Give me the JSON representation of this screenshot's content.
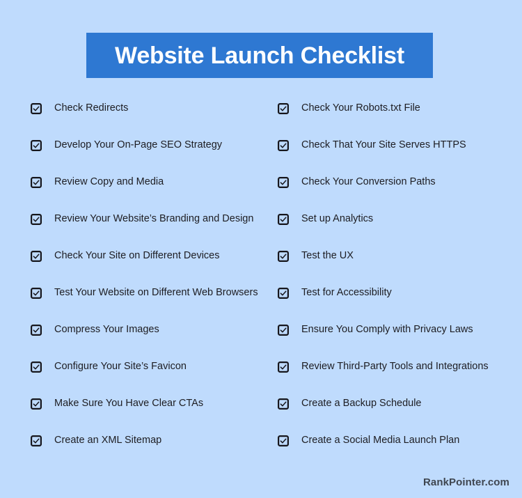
{
  "header": {
    "title": "Website Launch Checklist",
    "banner_color": "#2e78d2",
    "title_color": "#ffffff"
  },
  "page": {
    "background_color": "#bfdbfd",
    "text_color": "#1d1d22"
  },
  "checklist": {
    "checkbox_icon": "checkbox-checked-icon",
    "left_column": [
      {
        "label": "Check Redirects",
        "checked": true
      },
      {
        "label": "Develop Your On-Page SEO Strategy",
        "checked": true
      },
      {
        "label": "Review Copy and Media",
        "checked": true
      },
      {
        "label": "Review Your Website’s Branding and Design",
        "checked": true
      },
      {
        "label": "Check Your Site on Different Devices",
        "checked": true
      },
      {
        "label": "Test Your Website on Different Web Browsers",
        "checked": true
      },
      {
        "label": "Compress Your Images",
        "checked": true
      },
      {
        "label": "Configure Your Site’s Favicon",
        "checked": true
      },
      {
        "label": "Make Sure You Have Clear CTAs",
        "checked": true
      },
      {
        "label": "Create an XML Sitemap",
        "checked": true
      }
    ],
    "right_column": [
      {
        "label": "Check Your Robots.txt File",
        "checked": true
      },
      {
        "label": "Check That Your Site Serves HTTPS",
        "checked": true
      },
      {
        "label": "Check Your Conversion Paths",
        "checked": true
      },
      {
        "label": "Set up Analytics",
        "checked": true
      },
      {
        "label": "Test the UX",
        "checked": true
      },
      {
        "label": "Test for Accessibility",
        "checked": true
      },
      {
        "label": "Ensure You Comply with Privacy Laws",
        "checked": true
      },
      {
        "label": "Review Third-Party Tools and Integrations",
        "checked": true
      },
      {
        "label": "Create a Backup Schedule",
        "checked": true
      },
      {
        "label": "Create a Social Media Launch Plan",
        "checked": true
      }
    ]
  },
  "footer": {
    "brand": "RankPointer.com"
  }
}
